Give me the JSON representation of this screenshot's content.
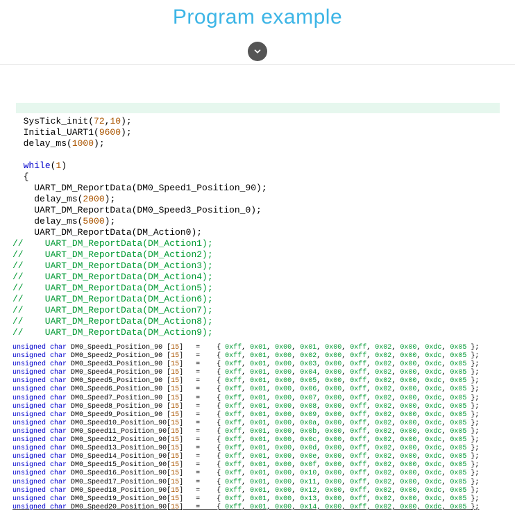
{
  "title": "Program example",
  "highlight": " ",
  "code1": {
    "l1_a": "  SysTick_init(",
    "l1_n1": "72",
    "l1_b": ",",
    "l1_n2": "10",
    "l1_c": ");",
    "l2_a": "  Initial_UART1(",
    "l2_n": "9600",
    "l2_b": ");",
    "l3_a": "  delay_ms(",
    "l3_n": "1000",
    "l3_b": ");",
    "blank1": " ",
    "l4_a": "  ",
    "l4_kw": "while",
    "l4_b": "(",
    "l4_n": "1",
    "l4_c": ")",
    "l5": "  {",
    "l6": "    UART_DM_ReportData(DM0_Speed1_Position_90);",
    "l7_a": "    delay_ms(",
    "l7_n": "2000",
    "l7_b": ");",
    "l8": "    UART_DM_ReportData(DM0_Speed3_Position_0);",
    "l9_a": "    delay_ms(",
    "l9_n": "5000",
    "l9_b": ");",
    "l10": "    UART_DM_ReportData(DM_Action0);",
    "c1": "//    UART_DM_ReportData(DM_Action1);",
    "c2": "//    UART_DM_ReportData(DM_Action2);",
    "c3": "//    UART_DM_ReportData(DM_Action3);",
    "c4": "//    UART_DM_ReportData(DM_Action4);",
    "c5": "//    UART_DM_ReportData(DM_Action5);",
    "c6": "//    UART_DM_ReportData(DM_Action6);",
    "c7": "//    UART_DM_ReportData(DM_Action7);",
    "c8": "//    UART_DM_ReportData(DM_Action8);",
    "c9": "//    UART_DM_ReportData(DM_Action9);"
  },
  "code2": {
    "rows": [
      {
        "name": "DM0_Speed1_Position_90",
        "idx": "0x01"
      },
      {
        "name": "DM0_Speed2_Position_90",
        "idx": "0x02"
      },
      {
        "name": "DM0_Speed3_Position_90",
        "idx": "0x03"
      },
      {
        "name": "DM0_Speed4_Position_90",
        "idx": "0x04"
      },
      {
        "name": "DM0_Speed5_Position_90",
        "idx": "0x05"
      },
      {
        "name": "DM0_Speed6_Position_90",
        "idx": "0x06"
      },
      {
        "name": "DM0_Speed7_Position_90",
        "idx": "0x07"
      },
      {
        "name": "DM0_Speed8_Position_90",
        "idx": "0x08"
      },
      {
        "name": "DM0_Speed9_Position_90",
        "idx": "0x09"
      },
      {
        "name": "DM0_Speed10_Position_90",
        "idx": "0x0a"
      },
      {
        "name": "DM0_Speed11_Position_90",
        "idx": "0x0b"
      },
      {
        "name": "DM0_Speed12_Position_90",
        "idx": "0x0c"
      },
      {
        "name": "DM0_Speed13_Position_90",
        "idx": "0x0d"
      },
      {
        "name": "DM0_Speed14_Position_90",
        "idx": "0x0e"
      },
      {
        "name": "DM0_Speed15_Position_90",
        "idx": "0x0f"
      },
      {
        "name": "DM0_Speed16_Position_90",
        "idx": "0x10"
      },
      {
        "name": "DM0_Speed17_Position_90",
        "idx": "0x11"
      },
      {
        "name": "DM0_Speed18_Position_90",
        "idx": "0x12"
      },
      {
        "name": "DM0_Speed19_Position_90",
        "idx": "0x13"
      },
      {
        "name": "DM0_Speed20_Position_90",
        "idx": "0x14"
      }
    ],
    "kw_unsigned": "unsigned",
    "kw_char": "char",
    "arr_size": "15",
    "eq": "=",
    "lbr": "{ ",
    "rbr": " };",
    "h0": "0xff",
    "h1": "0x01",
    "h2": "0x00",
    "h5": "0xff",
    "h6": "0x02",
    "h7": "0x00",
    "h8": "0xdc",
    "h9": "0x05",
    "h4": "0x00"
  }
}
